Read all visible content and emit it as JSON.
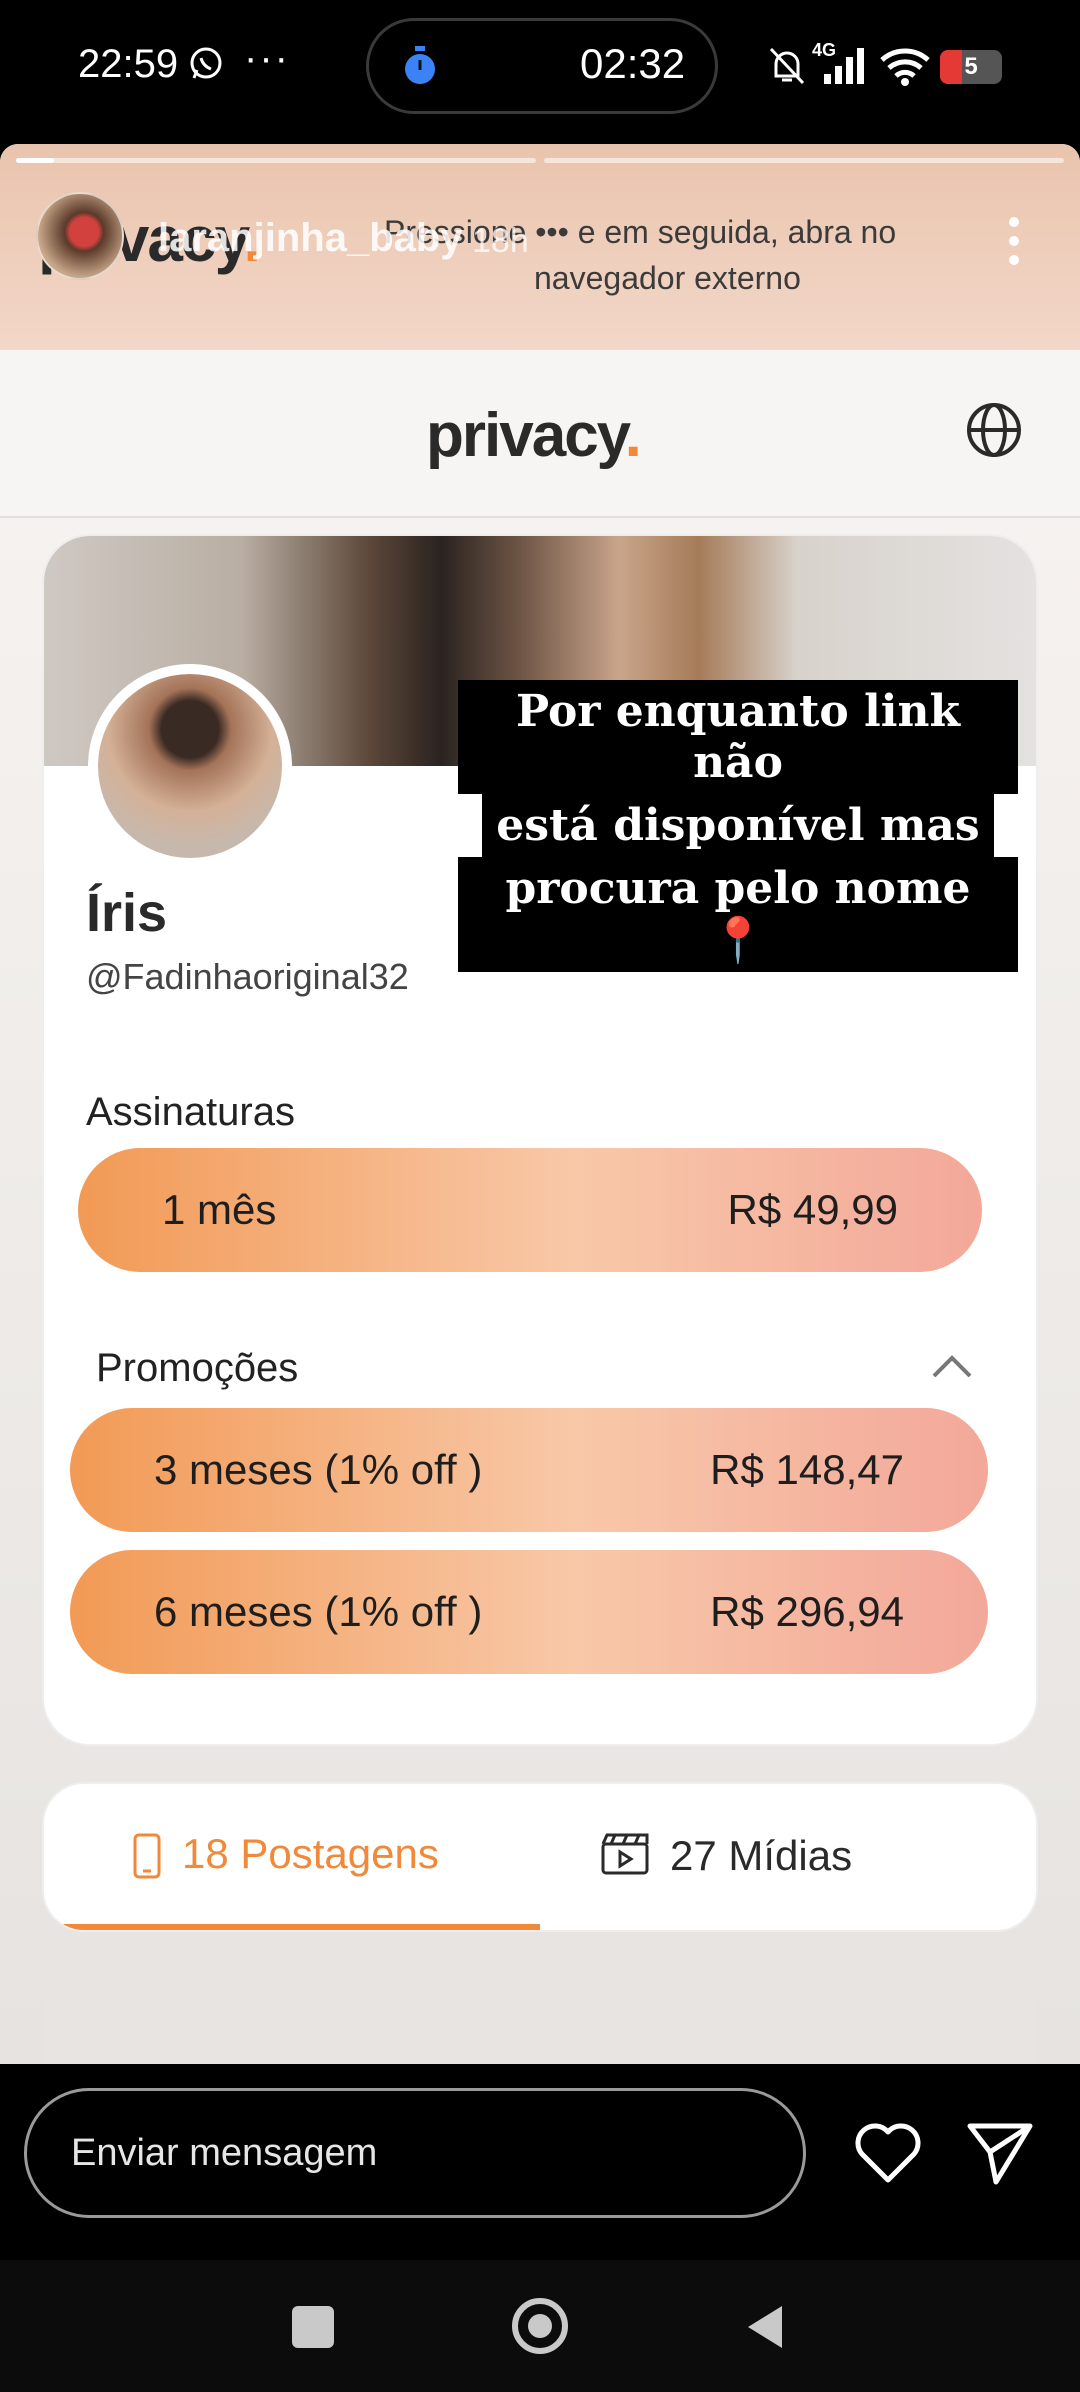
{
  "status_bar": {
    "time": "22:59",
    "more": "···",
    "timer": "02:32",
    "network": "4G",
    "battery": "5",
    "battery_fraction": 0.05
  },
  "story": {
    "username": "laranjinha_baby",
    "time_ago": "18h",
    "banner_logo": "privacy",
    "banner_line1": "Pressione  •••  e em seguida, abra no",
    "banner_line2": "navegador externo"
  },
  "site": {
    "logo": "privacy",
    "logo_dot": "."
  },
  "profile": {
    "name": "Íris",
    "handle": "@Fadinhaoriginal32"
  },
  "subscriptions": {
    "title": "Assinaturas",
    "plans": [
      {
        "label": "1 mês",
        "price": "R$ 49,99"
      }
    ]
  },
  "promotions": {
    "title": "Promoções",
    "items": [
      {
        "label": "3 meses (1% off )",
        "price": "R$ 148,47"
      },
      {
        "label": "6 meses (1% off )",
        "price": "R$ 296,94"
      }
    ]
  },
  "overlay_caption": {
    "line1": "Por enquanto link não",
    "line2": "está disponível mas",
    "line3": "procura pelo nome 📍"
  },
  "tabs": [
    {
      "label": "18 Postagens",
      "active": true
    },
    {
      "label": "27 Mídias",
      "active": false
    }
  ],
  "message_bar": {
    "placeholder": "Enviar mensagem"
  },
  "colors": {
    "brand_orange": "#f08a3a",
    "battery_red": "#e53935"
  }
}
